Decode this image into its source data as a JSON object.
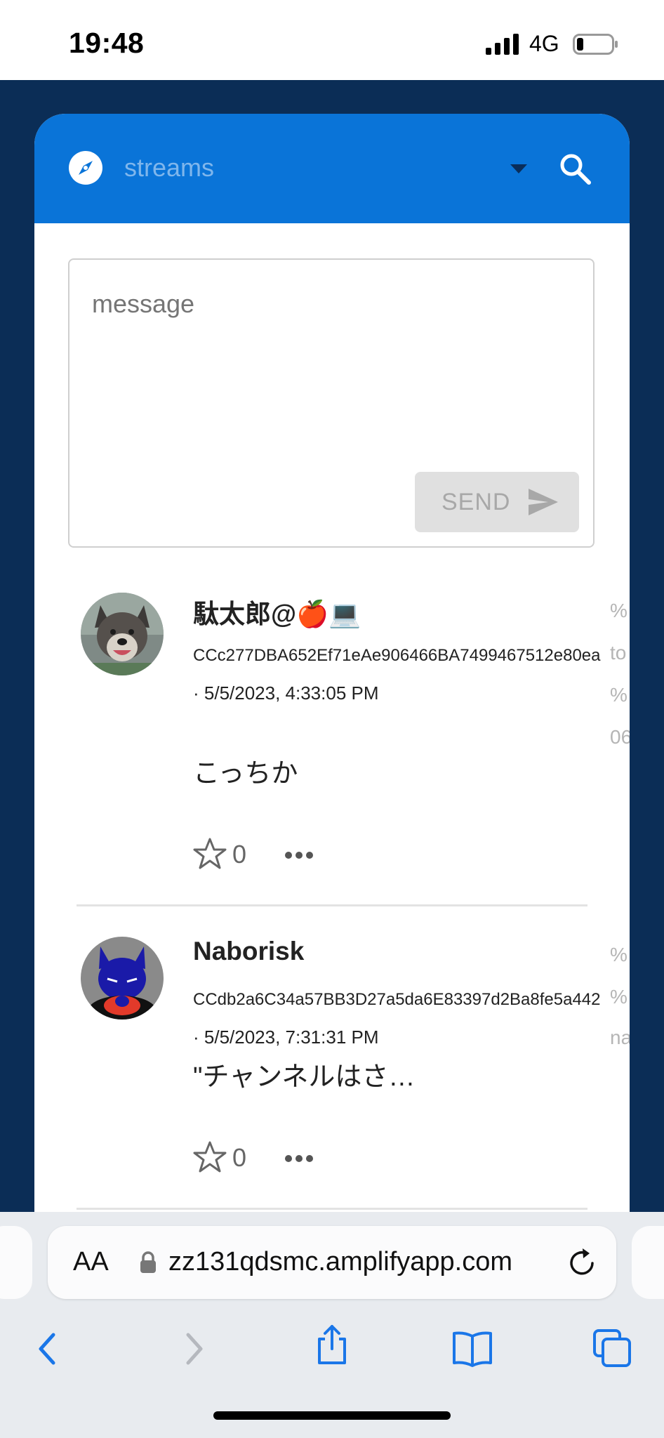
{
  "status_bar": {
    "time": "19:48",
    "network": "4G"
  },
  "app_bar": {
    "title": "streams",
    "icons": [
      "compass-icon",
      "dropdown-caret-icon",
      "search-icon"
    ]
  },
  "composer": {
    "placeholder": "message",
    "send_label": "SEND"
  },
  "posts": [
    {
      "username": "駄太郎@🍎💻",
      "address": "CCc277DBA652Ef71eAe906466BA7499467512e80ea",
      "date": "· 5/5/2023, 4:33:05 PM",
      "text": "こっちか",
      "likes": "0",
      "side": [
        "%",
        "to",
        "%",
        "06"
      ],
      "avatar": "wolf-avatar"
    },
    {
      "username": "Naborisk",
      "address": "CCdb2a6C34a57BB3D27a5da6E83397d2Ba8fe5a442",
      "date": "· 5/5/2023, 7:31:31 PM",
      "text": "\"チャンネルはさ…",
      "likes": "0",
      "side": [
        "%",
        "%",
        "na"
      ],
      "avatar": "fox-avatar"
    }
  ],
  "browser": {
    "aa_label": "AA",
    "url": "zz131qdsmc.amplifyapp.com",
    "toolbar": [
      "back-icon",
      "forward-icon",
      "share-icon",
      "bookmarks-icon",
      "tabs-icon"
    ]
  },
  "colors": {
    "app_blue": "#0a74d8",
    "page_navy": "#0b2d56"
  }
}
